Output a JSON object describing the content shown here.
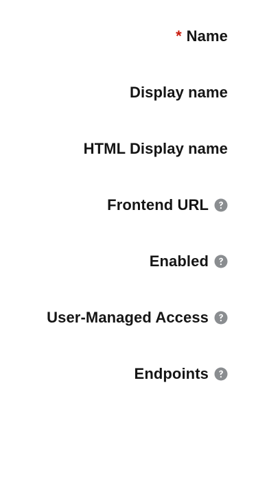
{
  "fields": {
    "name": {
      "label": "Name",
      "required_mark": "*"
    },
    "display_name": {
      "label": "Display name"
    },
    "html_display_name": {
      "label": "HTML Display name"
    },
    "frontend_url": {
      "label": "Frontend URL",
      "icon": "question-circle-icon"
    },
    "enabled": {
      "label": "Enabled",
      "icon": "question-circle-icon"
    },
    "user_managed_access": {
      "label": "User-Managed Access",
      "icon": "question-circle-icon"
    },
    "endpoints": {
      "label": "Endpoints",
      "icon": "question-circle-icon"
    }
  },
  "colors": {
    "label_text": "#151515",
    "required": "#c9190b",
    "help_icon": "#8a8d90"
  }
}
